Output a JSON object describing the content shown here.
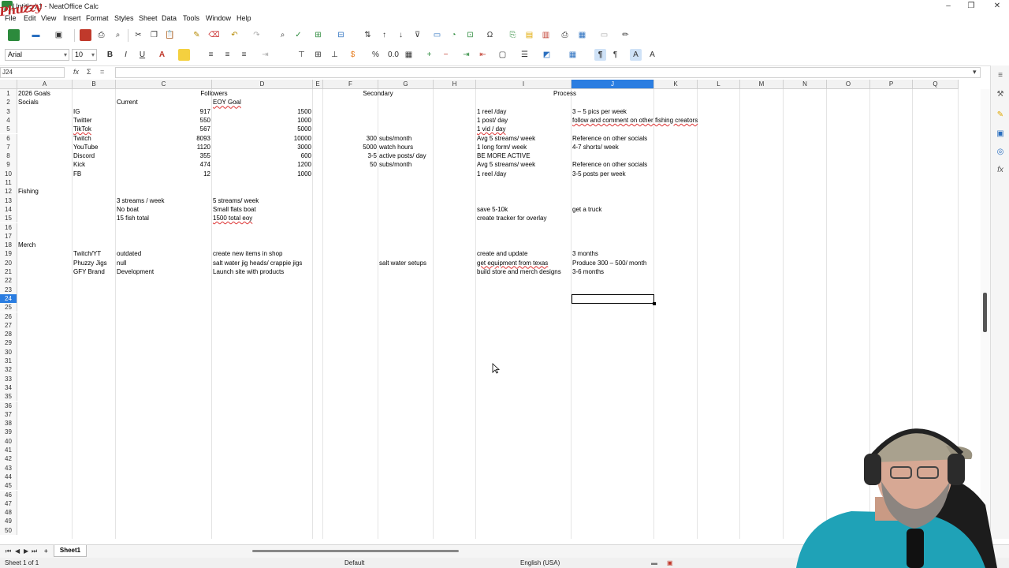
{
  "window": {
    "title": "Untitled 1 - NeatOffice Calc",
    "brand_overlay": "Phuzzy"
  },
  "menu": [
    "File",
    "Edit",
    "View",
    "Insert",
    "Format",
    "Styles",
    "Sheet",
    "Data",
    "Tools",
    "Window",
    "Help"
  ],
  "toolbar": {
    "font_name": "Arial",
    "font_size": "10",
    "percent_label": "%",
    "decimal_label": "0.0"
  },
  "formula_bar": {
    "name_box": "J24",
    "formula_value": ""
  },
  "columns": [
    "A",
    "B",
    "C",
    "D",
    "E",
    "F",
    "G",
    "H",
    "I",
    "J",
    "K",
    "L",
    "M",
    "N",
    "O",
    "P",
    "Q"
  ],
  "active_column": "J",
  "rows_visible": [
    "1",
    "2",
    "3",
    "4",
    "5",
    "6",
    "7",
    "8",
    "9",
    "10",
    "11",
    "12",
    "13",
    "14",
    "15",
    "16",
    "17",
    "18",
    "19",
    "20",
    "21",
    "22",
    "23",
    "24",
    "25",
    "26",
    "27",
    "28",
    "29",
    "30",
    "31",
    "32",
    "33",
    "34",
    "35",
    "36",
    "37",
    "38",
    "39",
    "40",
    "41",
    "42",
    "43",
    "44",
    "45",
    "46",
    "47",
    "48",
    "49",
    "50"
  ],
  "active_row": "24",
  "cells": [
    {
      "ref": "A1",
      "v": "2026 Goals"
    },
    {
      "ref": "C1",
      "v": "Followers",
      "align": "c",
      "span": 2
    },
    {
      "ref": "F1",
      "v": "Secondary",
      "align": "c",
      "span": 2
    },
    {
      "ref": "I1",
      "v": "Process",
      "align": "c",
      "span": 2
    },
    {
      "ref": "A2",
      "v": "Socials"
    },
    {
      "ref": "C2",
      "v": "Current"
    },
    {
      "ref": "D2",
      "v": "EOY Goal"
    },
    {
      "ref": "B3",
      "v": "IG"
    },
    {
      "ref": "C3",
      "v": "917",
      "align": "r"
    },
    {
      "ref": "D3",
      "v": "1500",
      "align": "r"
    },
    {
      "ref": "I3",
      "v": "1 reel /day"
    },
    {
      "ref": "J3",
      "v": "3 – 5 pics per week"
    },
    {
      "ref": "B4",
      "v": "Twitter"
    },
    {
      "ref": "C4",
      "v": "550",
      "align": "r"
    },
    {
      "ref": "D4",
      "v": "1000",
      "align": "r"
    },
    {
      "ref": "I4",
      "v": "1 post/ day"
    },
    {
      "ref": "J4",
      "v": "follow and comment on other fishing creators"
    },
    {
      "ref": "B5",
      "v": "TikTok"
    },
    {
      "ref": "C5",
      "v": "567",
      "align": "r"
    },
    {
      "ref": "D5",
      "v": "5000",
      "align": "r"
    },
    {
      "ref": "I5",
      "v": "1 vid / day"
    },
    {
      "ref": "B6",
      "v": "Twitch"
    },
    {
      "ref": "C6",
      "v": "8093",
      "align": "r"
    },
    {
      "ref": "D6",
      "v": "10000",
      "align": "r"
    },
    {
      "ref": "F6",
      "v": "300",
      "align": "r"
    },
    {
      "ref": "G6",
      "v": "subs/month"
    },
    {
      "ref": "I6",
      "v": "Avg 5 streams/ week"
    },
    {
      "ref": "J6",
      "v": "Reference on other socials"
    },
    {
      "ref": "B7",
      "v": "YouTube"
    },
    {
      "ref": "C7",
      "v": "1120",
      "align": "r"
    },
    {
      "ref": "D7",
      "v": "3000",
      "align": "r"
    },
    {
      "ref": "F7",
      "v": "5000",
      "align": "r"
    },
    {
      "ref": "G7",
      "v": "watch hours"
    },
    {
      "ref": "I7",
      "v": "1 long form/ week"
    },
    {
      "ref": "J7",
      "v": "4-7 shorts/ week"
    },
    {
      "ref": "B8",
      "v": "Discord"
    },
    {
      "ref": "C8",
      "v": "355",
      "align": "r"
    },
    {
      "ref": "D8",
      "v": "600",
      "align": "r"
    },
    {
      "ref": "F8",
      "v": "3-5",
      "align": "r"
    },
    {
      "ref": "G8",
      "v": "active posts/ day"
    },
    {
      "ref": "I8",
      "v": "BE MORE ACTIVE"
    },
    {
      "ref": "B9",
      "v": "Kick"
    },
    {
      "ref": "C9",
      "v": "474",
      "align": "r"
    },
    {
      "ref": "D9",
      "v": "1200",
      "align": "r"
    },
    {
      "ref": "F9",
      "v": "50",
      "align": "r"
    },
    {
      "ref": "G9",
      "v": "subs/month"
    },
    {
      "ref": "I9",
      "v": "Avg 5 streams/ week"
    },
    {
      "ref": "J9",
      "v": "Reference on other socials"
    },
    {
      "ref": "B10",
      "v": "FB"
    },
    {
      "ref": "C10",
      "v": "12",
      "align": "r"
    },
    {
      "ref": "D10",
      "v": "1000",
      "align": "r"
    },
    {
      "ref": "I10",
      "v": "1 reel /day"
    },
    {
      "ref": "J10",
      "v": "3-5 posts per week"
    },
    {
      "ref": "A12",
      "v": "Fishing"
    },
    {
      "ref": "C13",
      "v": "3 streams / week"
    },
    {
      "ref": "D13",
      "v": "5 streams/ week"
    },
    {
      "ref": "C14",
      "v": "No boat"
    },
    {
      "ref": "D14",
      "v": "Small flats boat"
    },
    {
      "ref": "I14",
      "v": "save 5-10k"
    },
    {
      "ref": "J14",
      "v": "get a truck"
    },
    {
      "ref": "C15",
      "v": "15 fish total"
    },
    {
      "ref": "D15",
      "v": "1500 total eoy"
    },
    {
      "ref": "I15",
      "v": "create tracker for overlay"
    },
    {
      "ref": "A18",
      "v": "Merch"
    },
    {
      "ref": "B19",
      "v": "Twitch/YT"
    },
    {
      "ref": "C19",
      "v": "outdated"
    },
    {
      "ref": "D19",
      "v": "create new items in shop"
    },
    {
      "ref": "I19",
      "v": "create and update"
    },
    {
      "ref": "J19",
      "v": " 3 months"
    },
    {
      "ref": "B20",
      "v": "Phuzzy Jigs"
    },
    {
      "ref": "C20",
      "v": "null"
    },
    {
      "ref": "D20",
      "v": "salt water jig heads/ crappie jigs"
    },
    {
      "ref": "G20",
      "v": "salt water setups"
    },
    {
      "ref": "I20",
      "v": "get equipment from texas"
    },
    {
      "ref": "J20",
      "v": "Produce 300 – 500/ month"
    },
    {
      "ref": "B21",
      "v": "GFY Brand"
    },
    {
      "ref": "C21",
      "v": "Development"
    },
    {
      "ref": "D21",
      "v": "Launch site with products"
    },
    {
      "ref": "I21",
      "v": "build store and merch designs"
    },
    {
      "ref": "J21",
      "v": "3-6 months"
    }
  ],
  "sheet_tab": "Sheet1",
  "status": {
    "sheet_of": "Sheet 1 of 1",
    "page_style": "Default",
    "language": "English (USA)"
  }
}
